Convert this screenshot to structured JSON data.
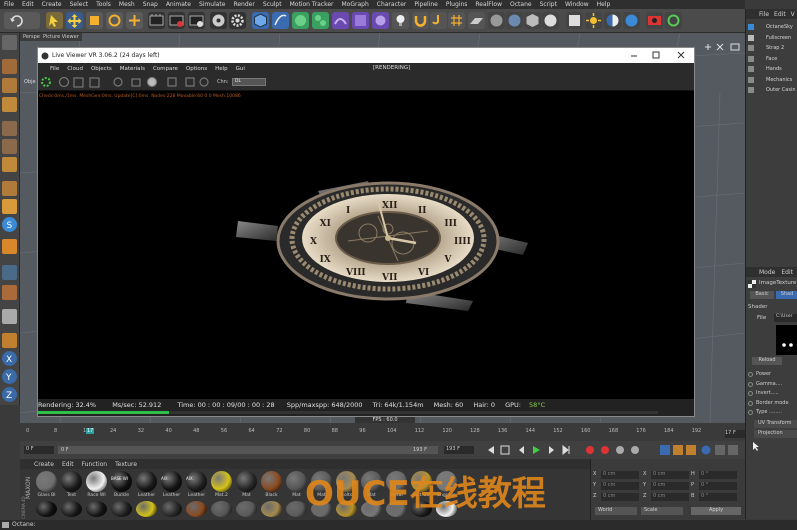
{
  "menubar": {
    "items": [
      "File",
      "Edit",
      "Create",
      "Select",
      "Tools",
      "Mesh",
      "Snap",
      "Animate",
      "Simulate",
      "Render",
      "Sculpt",
      "Motion Tracker",
      "MoGraph",
      "Character",
      "Pipeline",
      "Plugins",
      "RealFlow",
      "Octane",
      "Script",
      "Window",
      "Help"
    ]
  },
  "viewport": {
    "tabs": [
      "Perspe",
      "Picture Viewer"
    ]
  },
  "live_viewer": {
    "title": "Live Viewer VR 3.06.2 (24 days left)",
    "menu": [
      "File",
      "Cloud",
      "Objects",
      "Materials",
      "Compare",
      "Options",
      "Help",
      "Gui"
    ],
    "status_top": "[RENDERING]",
    "side_label": "Obje",
    "chn_label": "Chn:",
    "chn_value": "DL",
    "info_line": "Check:0ms./1ms. MeshGen:0ms. Update[C]:0ms. Nodes:228 Movable:60  0 0 Mesh:10086",
    "status": {
      "rendering": "Rendering: 32.4%",
      "ms": "Ms/sec: 52.912",
      "time": "Time: 00 : 00 : 09/00 : 00 : 28",
      "spp": "Spp/maxspp: 648/2000",
      "tri": "Tri: 64k/1.154m",
      "mesh": "Mesh: 60",
      "hair": "Hair: 0",
      "gpu": "GPU:",
      "temp": "58°C",
      "progress": 0.324
    }
  },
  "dial_numerals": [
    "XII",
    "II",
    "III",
    "IIII",
    "V",
    "VI",
    "VII",
    "VIII",
    "IX",
    "X",
    "XI",
    "I"
  ],
  "right_panel": {
    "menu": [
      "File",
      "Edit",
      "V"
    ],
    "objects": [
      "OctaneSky",
      "Fullscreen",
      "Strap 2",
      "Face",
      "Hands",
      "Mechanics",
      "Outer Casin"
    ],
    "attr_menu": [
      "Mode",
      "Edit"
    ],
    "attr_title": "ImageTexture",
    "attr_tabs": [
      "Basic",
      "Shad"
    ],
    "shader_label": "Shader",
    "file_label": "File",
    "file_value": "C:\\User",
    "reload": "Reload",
    "props": [
      "Power",
      "Gamma....",
      "Invert.....",
      "Border mode",
      "Type ........"
    ],
    "uv_transform": "UV Transform",
    "projection": "Projection"
  },
  "fps": "FPS : 60.0",
  "timeline": {
    "ticks": [
      "0",
      "8",
      "16",
      "17",
      "24",
      "32",
      "40",
      "48",
      "56",
      "64",
      "72",
      "80",
      "88",
      "96",
      "104",
      "112",
      "120",
      "128",
      "136",
      "144",
      "152",
      "160",
      "168",
      "176",
      "184",
      "192"
    ],
    "current": "17",
    "end_label": "17 F",
    "start_field": "0 F",
    "min_field": "0 F",
    "max_field": "193 F",
    "end_field": "193 F"
  },
  "materials": {
    "menu": [
      "Create",
      "Edit",
      "Function",
      "Texture"
    ],
    "row1": [
      "Glass Bl",
      "Text",
      "Race Wl",
      "Buckle",
      "Leather",
      "Leather",
      "Leather",
      "Mat.2",
      "Mat",
      "Black",
      "Mat",
      "Mat",
      "Bolts",
      "Mat",
      "Metal",
      "Bolt Gol",
      "Engrave"
    ],
    "colors": [
      "#6e6e6e",
      "#1a1a1a",
      "#f2f2f2",
      "#101010",
      "#181818",
      "#141414",
      "#1e1e1e",
      "#d4c21a",
      "#262626",
      "#8a4a20",
      "#555",
      "#5a5a5a",
      "#a58a50",
      "#5a5a5a",
      "#6a6a6a",
      "#b7932e",
      "#777"
    ],
    "aix_label": "AIX",
    "base_label": "BASE WI"
  },
  "coords": {
    "labels": [
      "X",
      "Y",
      "Z"
    ],
    "labels2": [
      "X",
      "Y",
      "Z"
    ],
    "labels3": [
      "H",
      "P",
      "B"
    ],
    "values": [
      "0 cm",
      "0 cm",
      "0 cm"
    ],
    "values2": [
      "0 cm",
      "0 cm",
      "0 cm"
    ],
    "values3": [
      "0 °",
      "0 °",
      "0 °"
    ],
    "world": "World",
    "scale": "Scale",
    "apply": "Apply"
  },
  "bottom": {
    "text": "Octane:"
  },
  "brand": {
    "maxon": "MAXON",
    "cinema": "CINEMA 4D"
  },
  "watermark": "OUCE在线教程"
}
